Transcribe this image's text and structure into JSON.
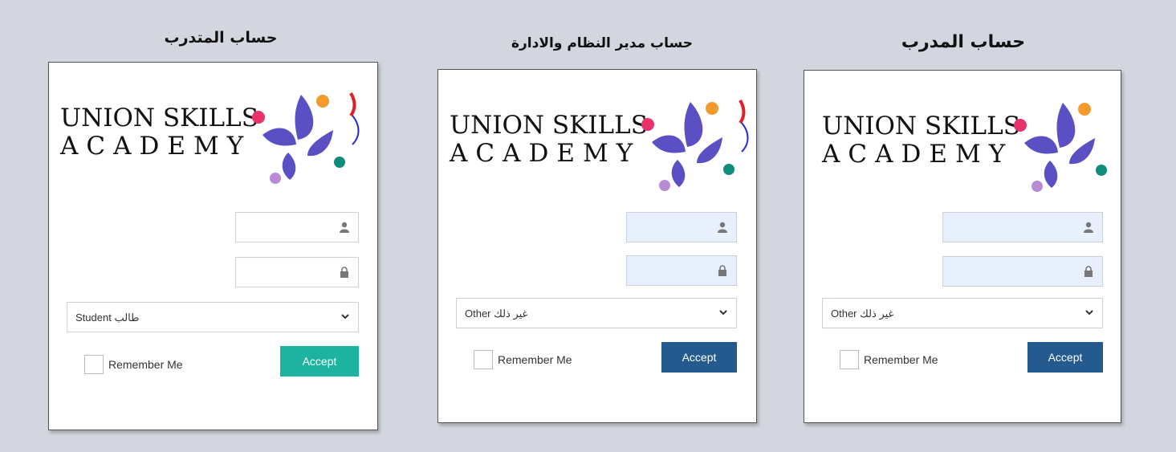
{
  "colors": {
    "background": "#d3d6df",
    "teal_button": "#1db3a0",
    "navy_button": "#245a8d",
    "logo_purple": "#5b4fc4",
    "logo_orange": "#f29a2e",
    "logo_pink": "#e8336a",
    "logo_green": "#0f8c7a",
    "logo_violet": "#b88ad6",
    "logo_blue": "#2b2bd6",
    "logo_red": "#e21f26"
  },
  "logo": {
    "line1": "UNION SKILLS",
    "line2": "ACADEMY"
  },
  "panels": [
    {
      "title": "حساب المتدرب",
      "username_value": "",
      "password_value": "",
      "user_icon": "user-icon",
      "lock_icon": "lock-icon",
      "account_type": "Student طالب",
      "remember_label": "Remember Me",
      "accept_label": "Accept"
    },
    {
      "title": "حساب مدير النظام والادارة",
      "username_value": "",
      "password_value": "",
      "user_icon": "user-icon",
      "lock_icon": "lock-icon",
      "account_type": "Other غير ذلك",
      "remember_label": "Remember Me",
      "accept_label": "Accept"
    },
    {
      "title": "حساب المدرب",
      "username_value": "",
      "password_value": "",
      "user_icon": "user-icon",
      "lock_icon": "lock-icon",
      "account_type": "Other غير ذلك",
      "remember_label": "Remember Me",
      "accept_label": "Accept"
    }
  ]
}
